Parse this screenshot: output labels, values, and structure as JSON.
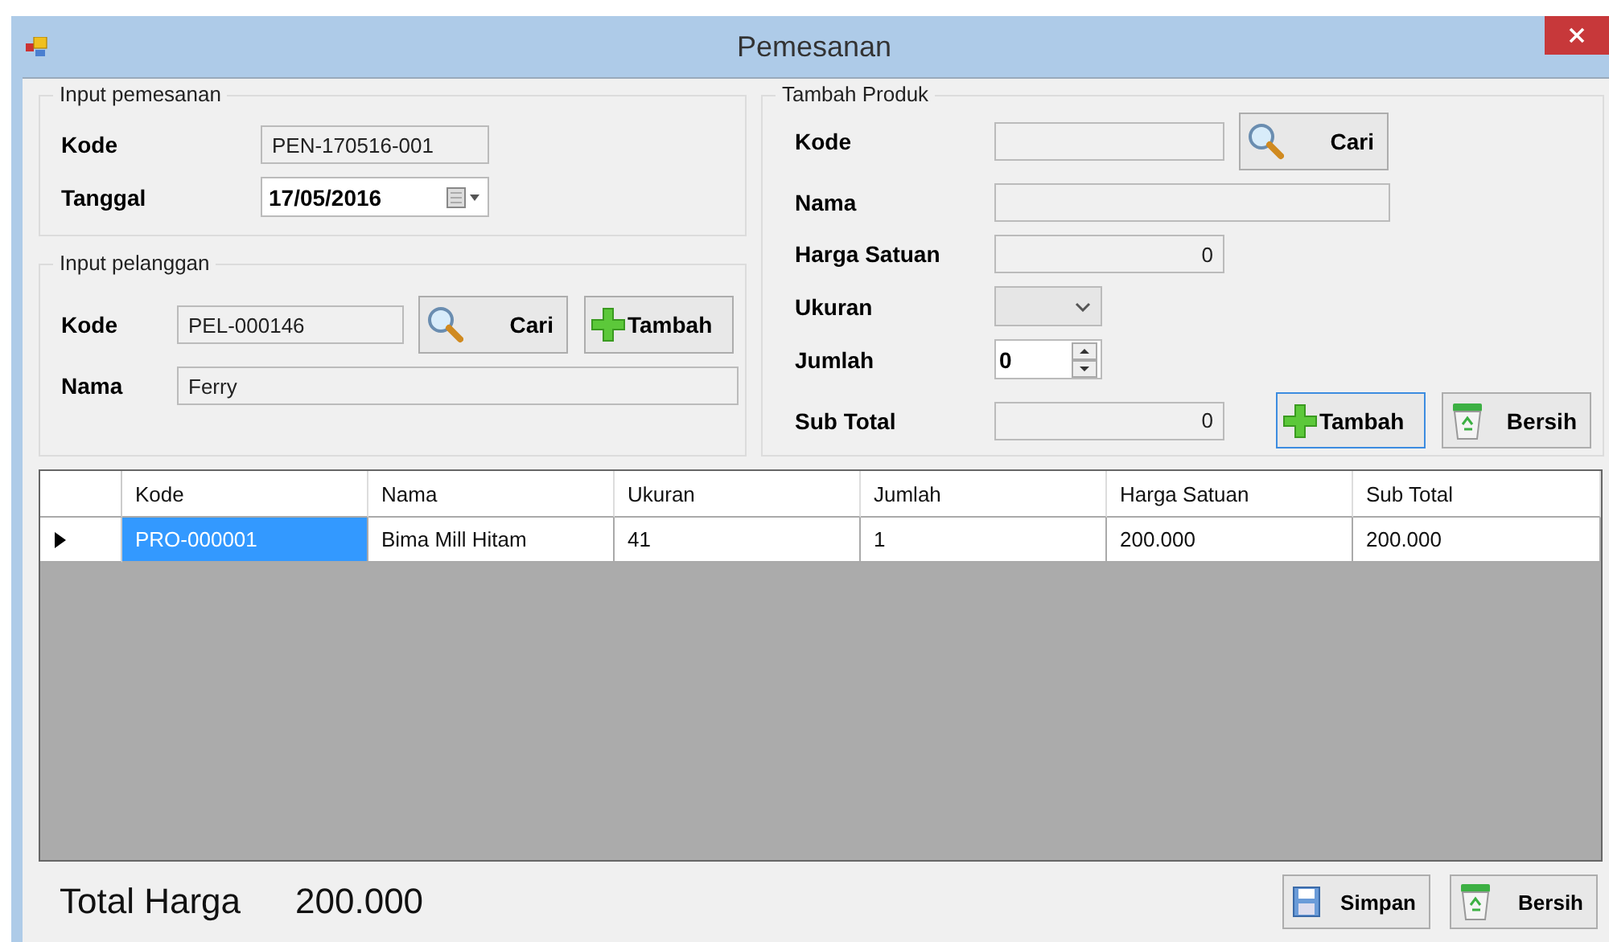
{
  "window": {
    "title": "Pemesanan"
  },
  "order_group": {
    "title": "Input pemesanan",
    "fields": [
      {
        "label": "Kode",
        "value": "PEN-170516-001",
        "kind": "text"
      },
      {
        "label": "Tanggal",
        "value": "17/05/2016",
        "kind": "date"
      }
    ]
  },
  "customer_group": {
    "title": "Input pelanggan",
    "code_label": "Kode",
    "code_value": "PEL-000146",
    "search_button": "Cari",
    "add_button": "Tambah",
    "name_label": "Nama",
    "name_value": "Ferry"
  },
  "product_group": {
    "title": "Tambah Produk",
    "search_button": "Cari",
    "fields": [
      {
        "label": "Kode",
        "kind": "text"
      },
      {
        "label": "Nama",
        "kind": "wide"
      },
      {
        "label": "Harga Satuan",
        "value": "0",
        "kind": "number"
      },
      {
        "label": "Ukuran",
        "kind": "combo"
      },
      {
        "label": "Jumlah",
        "value": "0",
        "kind": "spin"
      },
      {
        "label": "Sub Total",
        "value": "0",
        "kind": "number"
      }
    ],
    "add_button": "Tambah",
    "clear_button": "Bersih"
  },
  "table": {
    "columns": [
      "Kode",
      "Nama",
      "Ukuran",
      "Jumlah",
      "Harga Satuan",
      "Sub Total"
    ],
    "rows": [
      {
        "selected": true,
        "cells": [
          "PRO-000001",
          "Bima Mill Hitam",
          "41",
          "1",
          "200.000",
          "200.000"
        ]
      }
    ]
  },
  "footer": {
    "total_label": "Total Harga",
    "total_value": "200.000",
    "save_button": "Simpan",
    "clear_button": "Bersih"
  }
}
